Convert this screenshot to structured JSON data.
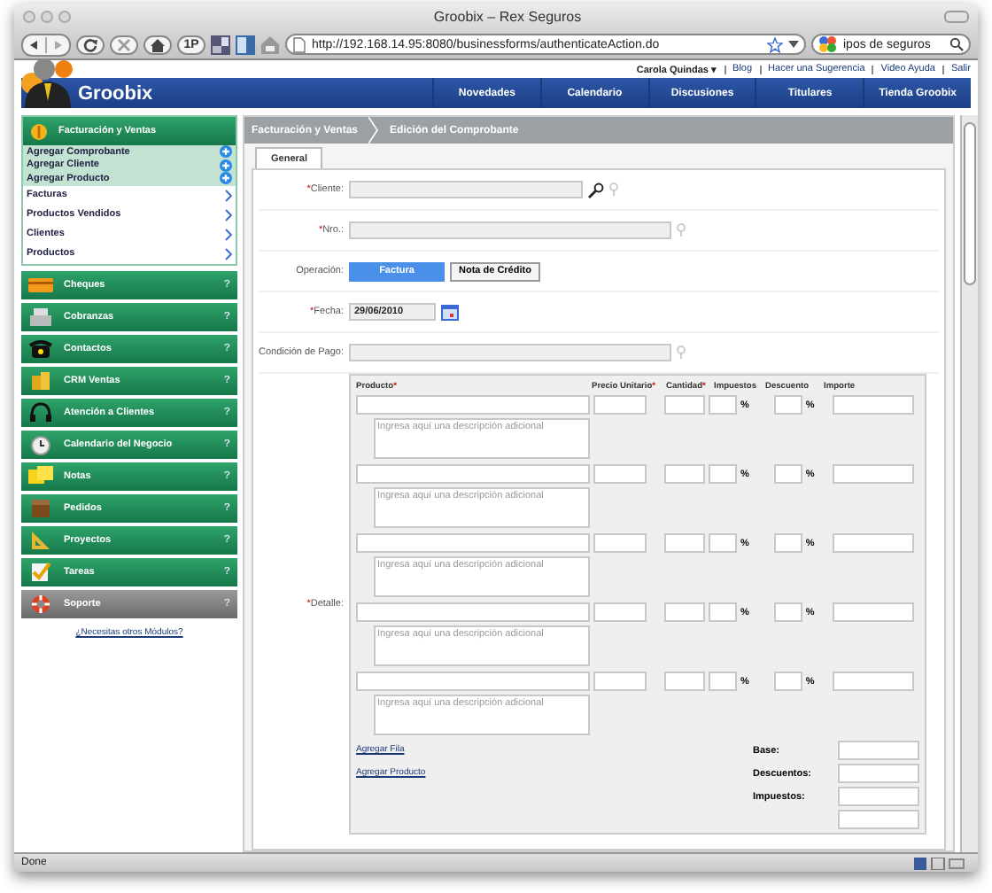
{
  "window": {
    "title": "Groobix – Rex Seguros"
  },
  "toolbar": {
    "page_button": "1P",
    "url": "http://192.168.14.95:8080/businessforms/authenticateAction.do",
    "search_value": "ipos de seguros"
  },
  "top_links": [
    {
      "label": "Carola Quindas ▾"
    },
    {
      "label": "Blog"
    },
    {
      "label": "Hacer una Sugerencia"
    },
    {
      "label": "Video Ayuda"
    },
    {
      "label": "Salir"
    }
  ],
  "logo": "Groobix",
  "nav": [
    "Novedades",
    "Calendario",
    "Discusiones",
    "Titulares",
    "Tienda Groobix"
  ],
  "sidebar": {
    "active_module": "Facturación y Ventas",
    "actions": [
      {
        "label": "Agregar Comprobante",
        "kind": "add"
      },
      {
        "label": "Agregar Cliente",
        "kind": "add"
      },
      {
        "label": "Agregar Producto",
        "kind": "add"
      },
      {
        "label": "Facturas",
        "kind": "link"
      },
      {
        "label": "Productos Vendidos",
        "kind": "link"
      },
      {
        "label": "Clientes",
        "kind": "link"
      },
      {
        "label": "Productos",
        "kind": "link"
      }
    ],
    "modules": [
      {
        "label": "Cheques",
        "help": "?",
        "kind": "module"
      },
      {
        "label": "Cobranzas",
        "help": "?",
        "kind": "module"
      },
      {
        "label": "Contactos",
        "help": "?",
        "kind": "module"
      },
      {
        "label": "CRM Ventas",
        "help": "?",
        "kind": "module"
      },
      {
        "label": "Atención a Clientes",
        "help": "?",
        "kind": "module"
      },
      {
        "label": "Calendario del Negocio",
        "help": "?",
        "kind": "module"
      },
      {
        "label": "Notas",
        "help": "?",
        "kind": "module"
      },
      {
        "label": "Pedidos",
        "help": "?",
        "kind": "module"
      },
      {
        "label": "Proyectos",
        "help": "?",
        "kind": "module"
      },
      {
        "label": "Tareas",
        "help": "?",
        "kind": "module"
      },
      {
        "label": "Soporte",
        "help": "?",
        "kind": "support"
      }
    ],
    "more_link": "¿Necesitas otros Módulos?"
  },
  "breadcrumb": [
    "Facturación y Ventas",
    "Edición del Comprobante"
  ],
  "tabs": [
    {
      "label": "General",
      "selected": true
    }
  ],
  "form": [
    {
      "label": "Cliente:",
      "mark": "*",
      "kind": "lookup"
    },
    {
      "label": "Nro.:",
      "mark": "*",
      "kind": "text"
    },
    {
      "label": "Operación:",
      "kind": "toggle",
      "options": [
        {
          "label": "Factura",
          "selected": true
        },
        {
          "label": "Nota de Crédito",
          "selected": false
        }
      ]
    },
    {
      "label": "Fecha:",
      "mark": "*",
      "kind": "date",
      "value": "29/06/2010"
    },
    {
      "label": "Condición de Pago:",
      "kind": "text"
    }
  ],
  "detail": {
    "label": "Detalle:",
    "mark": "*",
    "columns": [
      {
        "label": "Producto",
        "mark": "*"
      },
      {
        "label": "Precio Unitario",
        "mark": "*"
      },
      {
        "label": "Cantidad",
        "mark": "*"
      },
      {
        "label": "Impuestos"
      },
      {
        "label": "Descuento"
      },
      {
        "label": "Importe"
      }
    ],
    "rows": [
      {
        "placeholder": "Ingresa aquí una descripción adicional",
        "tax_unit": "%",
        "discount_unit": "%"
      },
      {
        "placeholder": "Ingresa aquí una descripción adicional",
        "tax_unit": "%",
        "discount_unit": "%"
      },
      {
        "placeholder": "Ingresa aquí una descripción adicional",
        "tax_unit": "%",
        "discount_unit": "%"
      },
      {
        "placeholder": "Ingresa aquí una descripción adicional",
        "tax_unit": "%",
        "discount_unit": "%"
      },
      {
        "placeholder": "Ingresa aquí una descripción adicional",
        "tax_unit": "%",
        "discount_unit": "%"
      }
    ],
    "links": [
      "Agregar Fila",
      "Agregar Producto"
    ],
    "totals": [
      "Base:",
      "Descuentos:",
      "Impuestos:"
    ]
  },
  "status_bar": "Done"
}
